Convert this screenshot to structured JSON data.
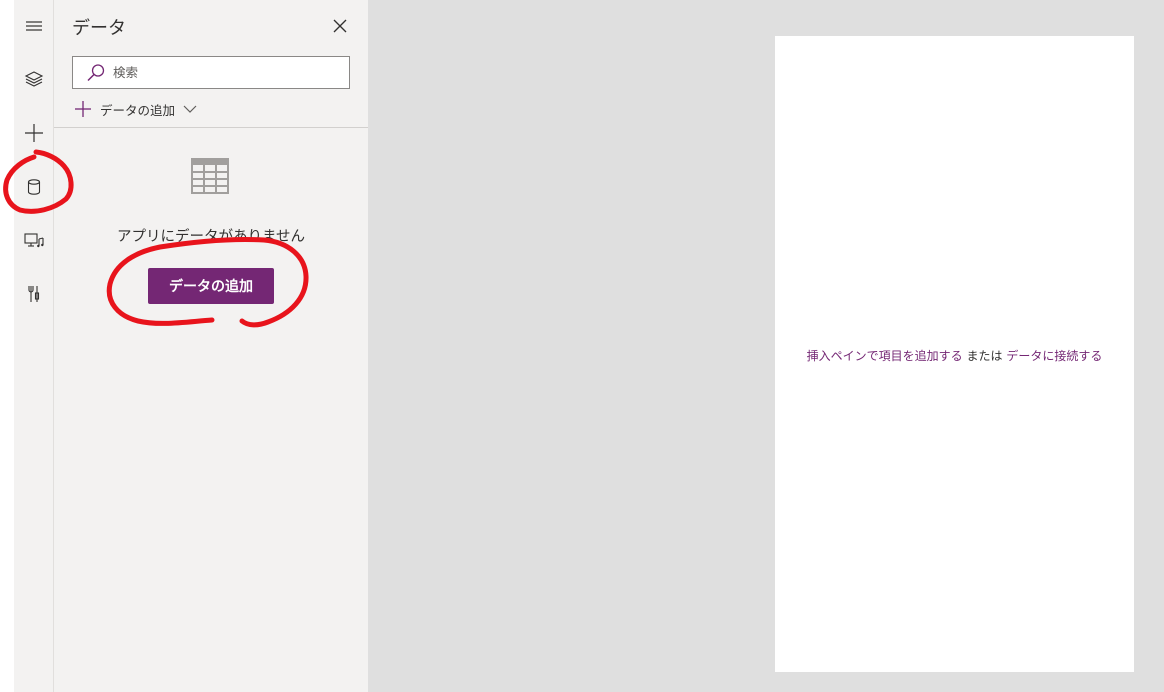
{
  "rail": {
    "items": [
      {
        "icon": "hamburger-icon"
      },
      {
        "icon": "layers-icon"
      },
      {
        "icon": "plus-icon"
      },
      {
        "icon": "database-icon",
        "selected": true
      },
      {
        "icon": "media-icon"
      },
      {
        "icon": "tools-icon"
      }
    ]
  },
  "panel": {
    "title": "データ",
    "search": {
      "placeholder": "検索",
      "value": ""
    },
    "add_data_label": "データの追加",
    "empty_message": "アプリにデータがありません",
    "add_data_button": "データの追加"
  },
  "canvas": {
    "hint_link1": "挿入ペインで項目を追加する",
    "hint_middle": "または",
    "hint_link2": "データに接続する"
  },
  "colors": {
    "accent": "#742774",
    "annotation": "#e8141c",
    "workspace": "#dfdfdf",
    "panel": "#f3f2f1"
  }
}
